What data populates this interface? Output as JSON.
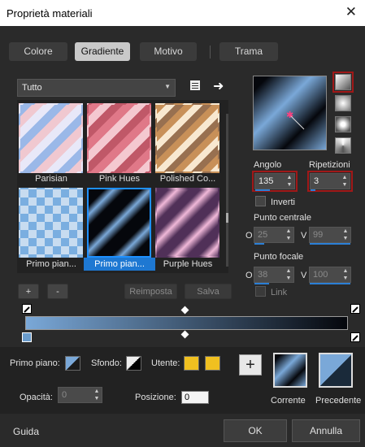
{
  "window": {
    "title": "Proprietà materiali",
    "close": "✕"
  },
  "tabs": [
    "Colore",
    "Gradiente",
    "Motivo",
    "Trama"
  ],
  "dropdown": {
    "value": "Tutto"
  },
  "swatches": [
    "Parisian",
    "Pink Hues",
    "Polished Co...",
    "Primo pian...",
    "Primo pian...",
    "Purple Hues"
  ],
  "buttons": {
    "add": "+",
    "remove": "-",
    "reset": "Reimposta",
    "save": "Salva",
    "ok": "OK",
    "cancel": "Annulla",
    "help": "Guida"
  },
  "fields": {
    "angle_label": "Angolo",
    "angle": "135",
    "repeat_label": "Ripetizioni",
    "repeat": "3",
    "invert_label": "Inverti",
    "center_label": "Punto centrale",
    "center_o": "25",
    "center_v": "99",
    "focal_label": "Punto focale",
    "focal_o": "38",
    "focal_v": "100",
    "link_label": "Link",
    "o": "O",
    "v": "V"
  },
  "bottom": {
    "fg_label": "Primo piano:",
    "bg_label": "Sfondo:",
    "user_label": "Utente:",
    "opacity_label": "Opacità:",
    "opacity": "0",
    "position_label": "Posizione:",
    "position": "0",
    "current_label": "Corrente",
    "previous_label": "Precedente"
  },
  "colors": {
    "accent": "#1e78d2",
    "user1": "#f0c020",
    "user2": "#f0c020",
    "grad_light": "#7aa8d8",
    "grad_dark": "#05070c"
  }
}
